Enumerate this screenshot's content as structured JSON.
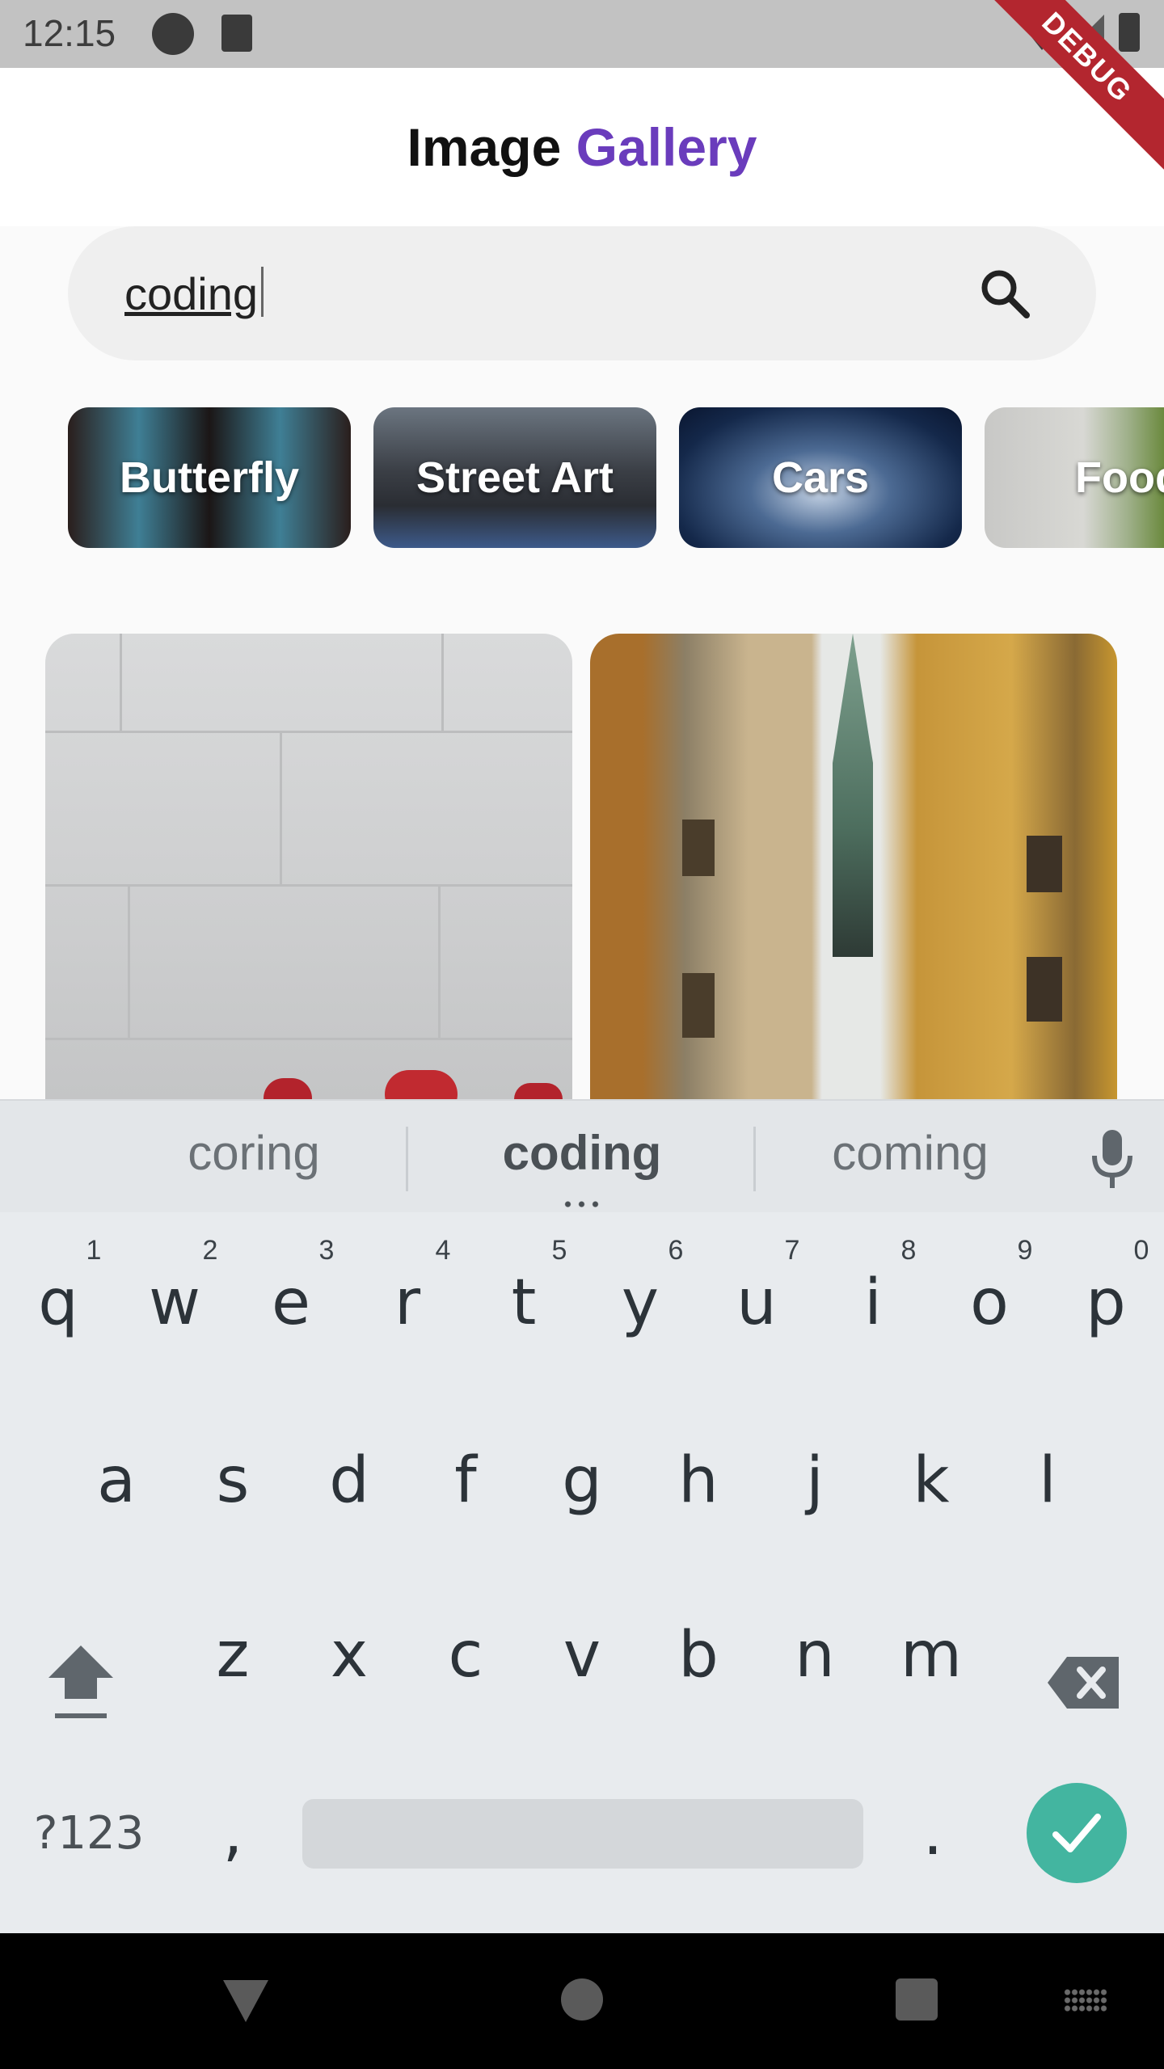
{
  "status_bar": {
    "time": "12:15"
  },
  "debug_banner": "DEBUG",
  "app_bar": {
    "title_part1": "Image ",
    "title_part2": "Gallery"
  },
  "search": {
    "value": "coding"
  },
  "categories": [
    {
      "label": "Butterfly"
    },
    {
      "label": "Street Art"
    },
    {
      "label": "Cars"
    },
    {
      "label": "Food"
    }
  ],
  "keyboard": {
    "suggestions": [
      "coring",
      "coding",
      "coming"
    ],
    "row1": [
      "q",
      "w",
      "e",
      "r",
      "t",
      "y",
      "u",
      "i",
      "o",
      "p"
    ],
    "row1_hints": [
      "1",
      "2",
      "3",
      "4",
      "5",
      "6",
      "7",
      "8",
      "9",
      "0"
    ],
    "row2": [
      "a",
      "s",
      "d",
      "f",
      "g",
      "h",
      "j",
      "k",
      "l"
    ],
    "row3": [
      "z",
      "x",
      "c",
      "v",
      "b",
      "n",
      "m"
    ],
    "symbols_label": "?123",
    "comma": ",",
    "period": "."
  },
  "colors": {
    "accent": "#6a3cbc",
    "enter": "#43b5a0",
    "debug": "#b3262f"
  }
}
